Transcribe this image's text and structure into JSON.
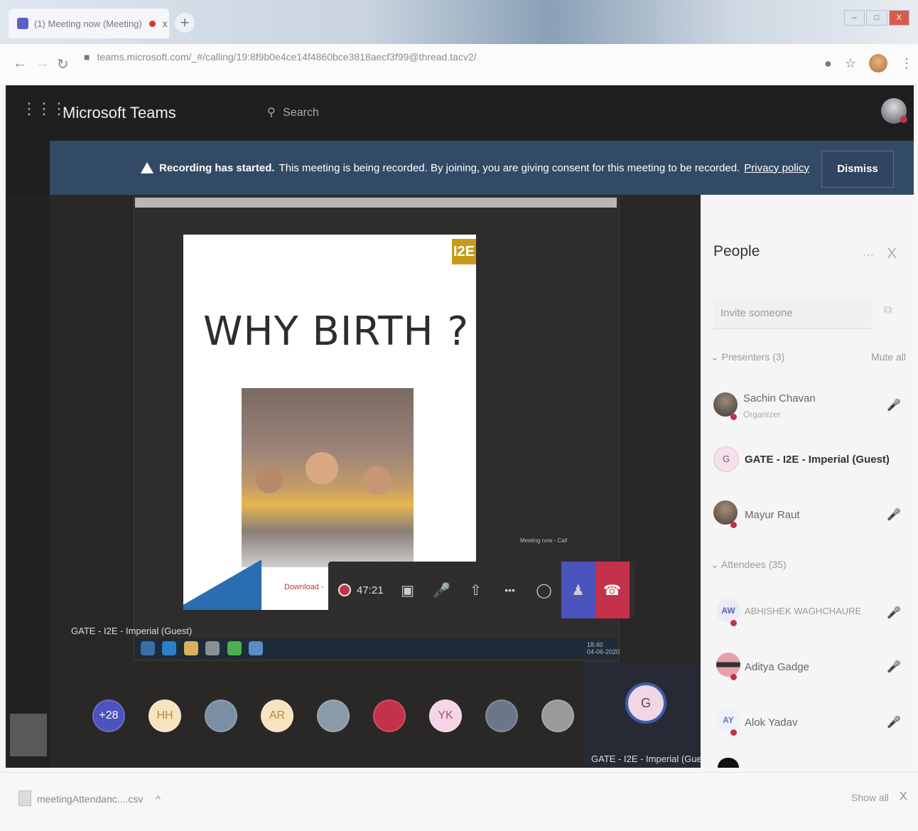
{
  "browser": {
    "tab_title": "(1) Meeting now (Meeting)",
    "tab_close": "x",
    "new_tab": "+",
    "url": "teams.microsoft.com/_#/calling/19:8f9b0e4ce14f4860bce3818aecf3f99@thread.tacv2/",
    "window_controls": [
      "–",
      "□",
      "X"
    ]
  },
  "teams": {
    "brand": "Microsoft Teams",
    "search_placeholder": "Search"
  },
  "banner": {
    "bold": "Recording has started.",
    "message": "This meeting is being recorded. By joining, you are giving consent for this meeting to be recorded.",
    "link": "Privacy policy",
    "dismiss": "Dismiss"
  },
  "stage": {
    "slide_title": "WHY  BIRTH ?",
    "logo": "I2E",
    "download_text": "Download -",
    "presenter_label": "GATE - I2E - Imperial (Guest)",
    "mini_recording": "Meeting now - Call",
    "clock": "18:40\n04-06-2020"
  },
  "controls": {
    "timer": "47:21",
    "more": "•••"
  },
  "participants_strip": [
    {
      "label": "+28",
      "bg": "#4b53bc",
      "fg": "#ffffff"
    },
    {
      "label": "HH",
      "bg": "#f6e3c0",
      "fg": "#b58737"
    },
    {
      "label": "",
      "bg": "#7a8fa3",
      "fg": "#ffffff"
    },
    {
      "label": "AR",
      "bg": "#f6e3c0",
      "fg": "#b58737"
    },
    {
      "label": "",
      "bg": "#8a9aa8",
      "fg": "#ffffff"
    },
    {
      "label": "",
      "bg": "#c4314b",
      "fg": "#ffffff"
    },
    {
      "label": "YK",
      "bg": "#f5d5e6",
      "fg": "#a05478"
    },
    {
      "label": "",
      "bg": "#6b7788",
      "fg": "#ffffff"
    },
    {
      "label": "",
      "bg": "#9a9a9a",
      "fg": "#ffffff"
    }
  ],
  "self_view": {
    "initial": "G",
    "name": "GATE - I2E - Imperial (Gue..."
  },
  "people": {
    "title": "People",
    "more": "···",
    "close": "X",
    "invite_placeholder": "Invite someone",
    "presenters_header": "Presenters (3)",
    "mute_all": "Mute all",
    "presenters": [
      {
        "name": "Sachin Chavan",
        "role": "Organizer"
      },
      {
        "name": "GATE - I2E - Imperial (Guest)",
        "role": "",
        "initial": "G"
      },
      {
        "name": "Mayur Raut",
        "role": ""
      }
    ],
    "attendees_header": "Attendees (35)",
    "attendees": [
      {
        "name": "ABHISHEK WAGHCHAURE",
        "initials": "AW"
      },
      {
        "name": "Aditya Gadge",
        "initials": ""
      },
      {
        "name": "Alok Yadav",
        "initials": "AY"
      }
    ]
  },
  "downloads": {
    "file": "meetingAttendanc....csv",
    "chevron": "^",
    "show_all": "Show all",
    "close": "X"
  }
}
